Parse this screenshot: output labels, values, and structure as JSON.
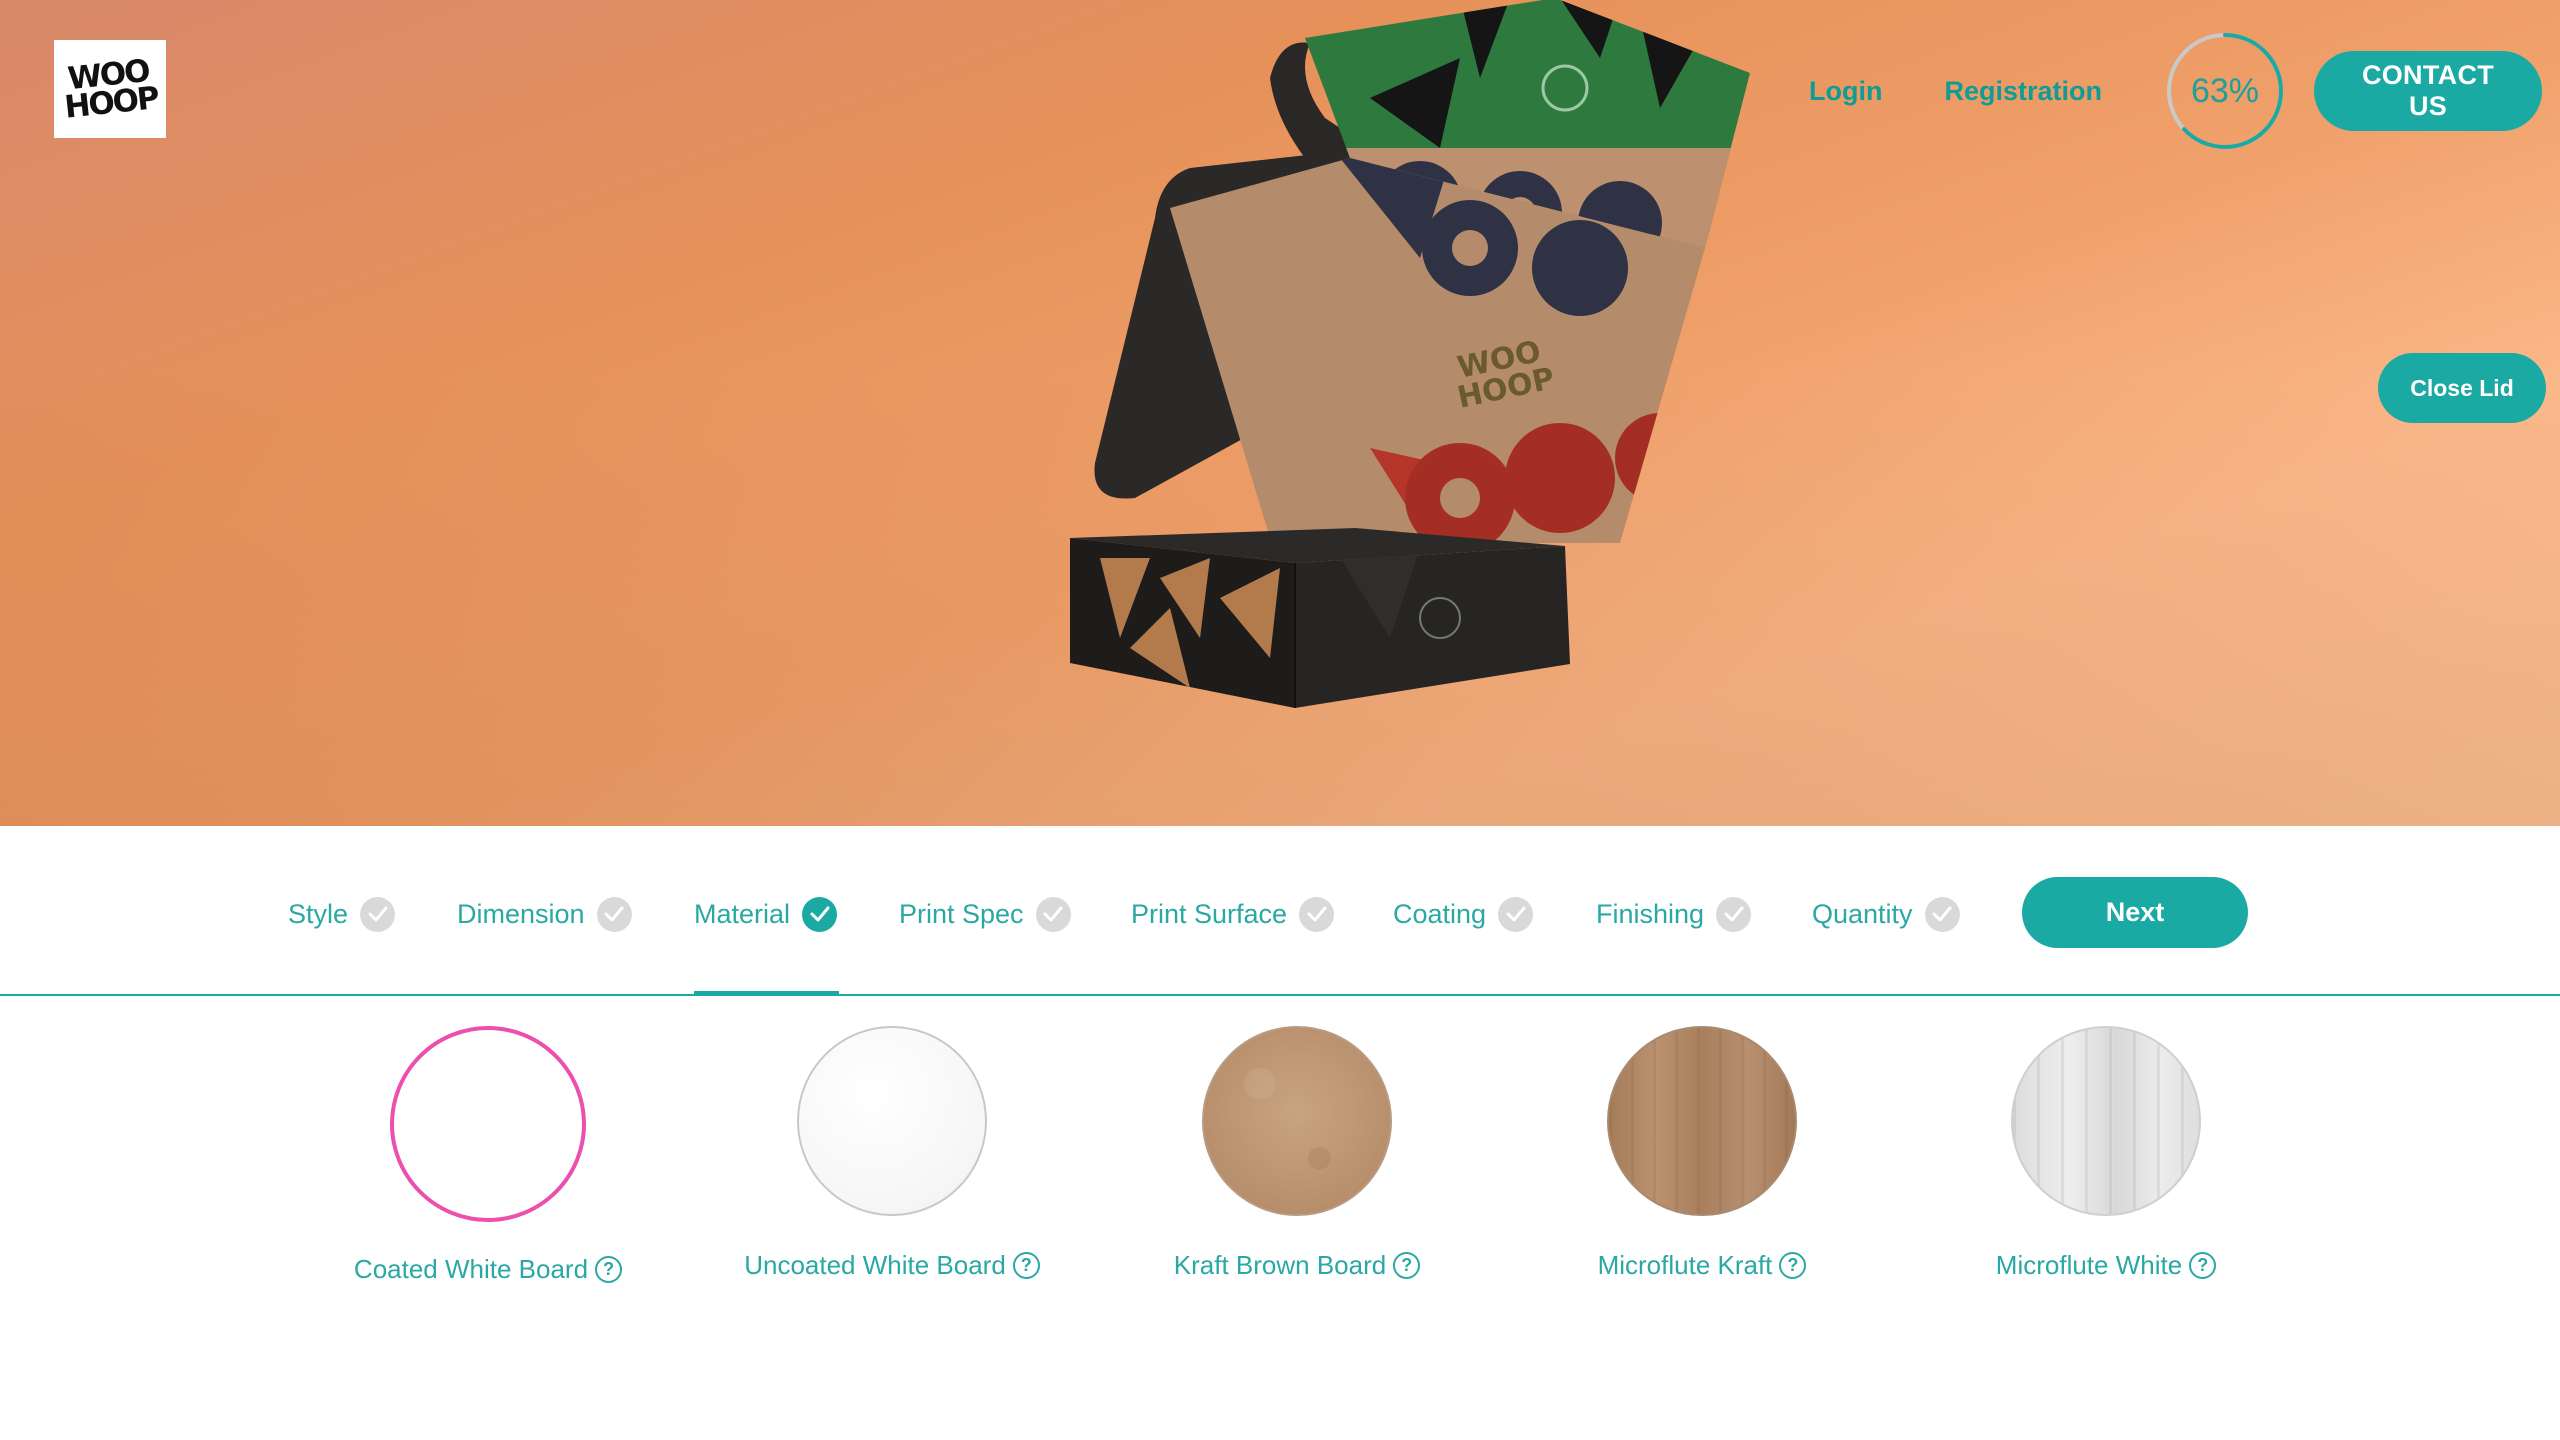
{
  "brand": {
    "logo_text": "WOO\nHOOP"
  },
  "nav": {
    "login": "Login",
    "registration": "Registration",
    "progress_text": "63%",
    "progress_value": 0.63,
    "contact": "CONTACT US"
  },
  "viewer": {
    "close_lid": "Close Lid"
  },
  "steps": {
    "items": [
      {
        "label": "Style",
        "active": false
      },
      {
        "label": "Dimension",
        "active": false
      },
      {
        "label": "Material",
        "active": true
      },
      {
        "label": "Print Spec",
        "active": false
      },
      {
        "label": "Print Surface",
        "active": false
      },
      {
        "label": "Coating",
        "active": false
      },
      {
        "label": "Finishing",
        "active": false
      },
      {
        "label": "Quantity",
        "active": false
      }
    ],
    "next": "Next"
  },
  "materials": {
    "items": [
      {
        "label": "Coated White Board",
        "selected": true
      },
      {
        "label": "Uncoated White Board",
        "selected": false
      },
      {
        "label": "Kraft Brown Board",
        "selected": false
      },
      {
        "label": "Microflute Kraft",
        "selected": false
      },
      {
        "label": "Microflute White",
        "selected": false
      }
    ]
  },
  "colors": {
    "accent": "#1ba9a3",
    "selected_ring": "#ec4fae",
    "check_inactive": "#d9d9d9"
  },
  "icons": {
    "step_check": "check-icon",
    "material_help": "question-circle-icon"
  }
}
